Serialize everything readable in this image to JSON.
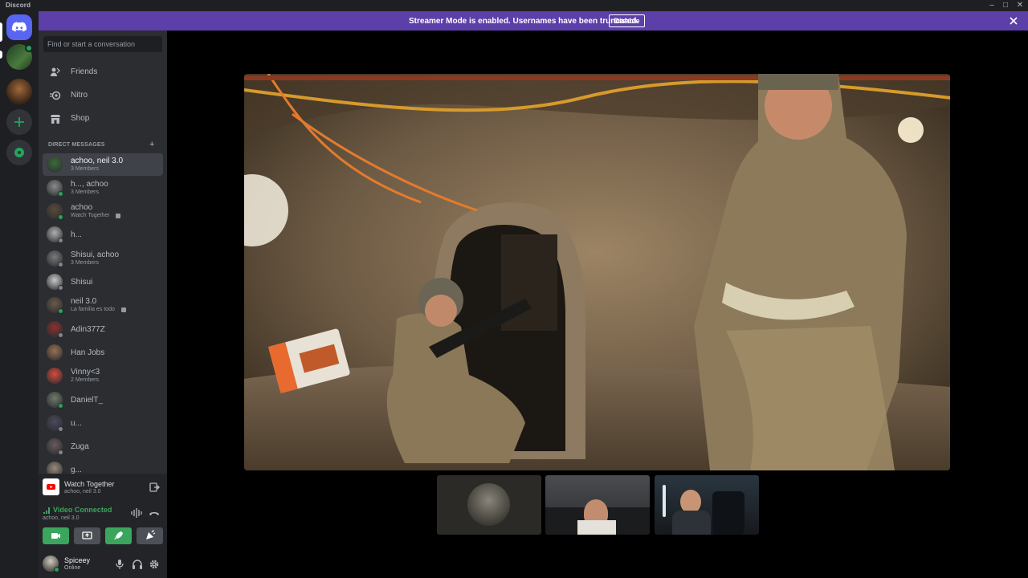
{
  "window": {
    "title": "Discord"
  },
  "banner": {
    "text": "Streamer Mode is enabled. Usernames have been truncated.",
    "button": "Disable"
  },
  "search": {
    "placeholder": "Find or start a conversation"
  },
  "nav": [
    {
      "label": "Friends",
      "icon": "friends-icon"
    },
    {
      "label": "Nitro",
      "icon": "nitro-icon"
    },
    {
      "label": "Shop",
      "icon": "shop-icon"
    }
  ],
  "dm_header": "DIRECT MESSAGES",
  "dms": [
    {
      "name": "achoo, neil 3.0",
      "sub": "3 Members"
    },
    {
      "name": "h..., achoo",
      "sub": "3 Members"
    },
    {
      "name": "achoo",
      "sub": "Watch Together"
    },
    {
      "name": "h...",
      "sub": ""
    },
    {
      "name": "Shisui, achoo",
      "sub": "3 Members"
    },
    {
      "name": "Shisui",
      "sub": ""
    },
    {
      "name": "neil 3.0",
      "sub": "La familia es todo"
    },
    {
      "name": "Adin377Z",
      "sub": ""
    },
    {
      "name": "Han Jobs",
      "sub": ""
    },
    {
      "name": "Vinny<3",
      "sub": "2 Members"
    },
    {
      "name": "DanielT_",
      "sub": ""
    },
    {
      "name": "u...",
      "sub": ""
    },
    {
      "name": "Zuga",
      "sub": ""
    },
    {
      "name": "g...",
      "sub": ""
    }
  ],
  "activity": {
    "title": "Watch Together",
    "sub": "achoo, neil 3.0"
  },
  "voice": {
    "status": "Video Connected",
    "channel": "achoo, neil 3.0"
  },
  "user": {
    "name": "Spiceey",
    "status": "Online"
  },
  "colors": {
    "accent": "#5865f2",
    "banner": "#5c3fa8",
    "online": "#23a55a",
    "connected_green": "#3ba55d",
    "youtube_red": "#ff0000"
  }
}
